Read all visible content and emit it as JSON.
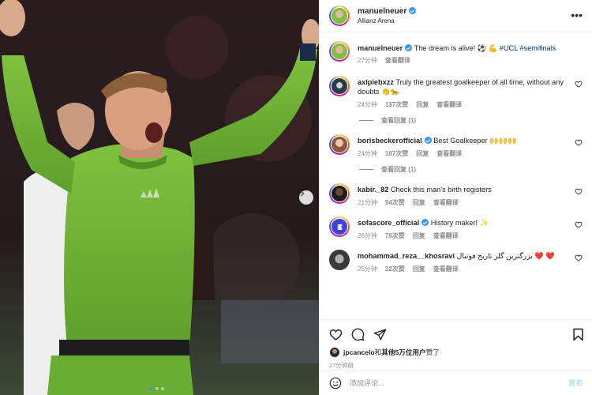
{
  "post": {
    "username": "manuelneuer",
    "location": "Allianz Arena",
    "more_icon": "more-horizontal-icon"
  },
  "caption": {
    "username": "manuelneuer",
    "text_prefix": "The dream is alive! ",
    "text_emoji": "⚽ 💪",
    "hashtags": "#UCL #semifinals",
    "time": "27分钟",
    "translate": "查看翻译"
  },
  "comments": [
    {
      "username": "axlpiebxzz",
      "text": "Truly the greatest goalkeeper of all time, without any doubts 👏🐆",
      "time": "24分钟",
      "likes": "137次赞",
      "reply": "回复",
      "translate": "查看翻译",
      "view_replies": "查看回复 (1)"
    },
    {
      "username": "borisbeckerofficial",
      "text": "Best Goalkeeper 🙌🙌🙌",
      "time": "24分钟",
      "likes": "187次赞",
      "reply": "回复",
      "translate": "查看翻译",
      "view_replies": "查看回复 (1)"
    },
    {
      "username": "kabir._82",
      "text": "Check this man's birth registers",
      "time": "21分钟",
      "likes": "94次赞",
      "reply": "回复",
      "translate": "查看翻译"
    },
    {
      "username": "sofascore_official",
      "text": "History maker! ✨",
      "time": "26分钟",
      "likes": "78次赞",
      "reply": "回复",
      "translate": "查看翻译"
    },
    {
      "username": "mohammad_reza__khosravi",
      "text": "بزرگترین گلر تاریخ فوتبال ❤️ ❤️",
      "time": "25分钟",
      "likes": "12次赞",
      "reply": "回复",
      "translate": "查看翻译"
    }
  ],
  "likes": {
    "user": "jpcancelo",
    "text_mid": "和",
    "others": "其他5万位用户",
    "text_end": "赞了"
  },
  "post_time": "27分钟前",
  "add_comment": {
    "placeholder": "添加评论...",
    "post_label": "发布"
  },
  "colors": {
    "jersey": "#6fb335",
    "accent": "#3897f0",
    "heart_red": "#ed4956"
  }
}
